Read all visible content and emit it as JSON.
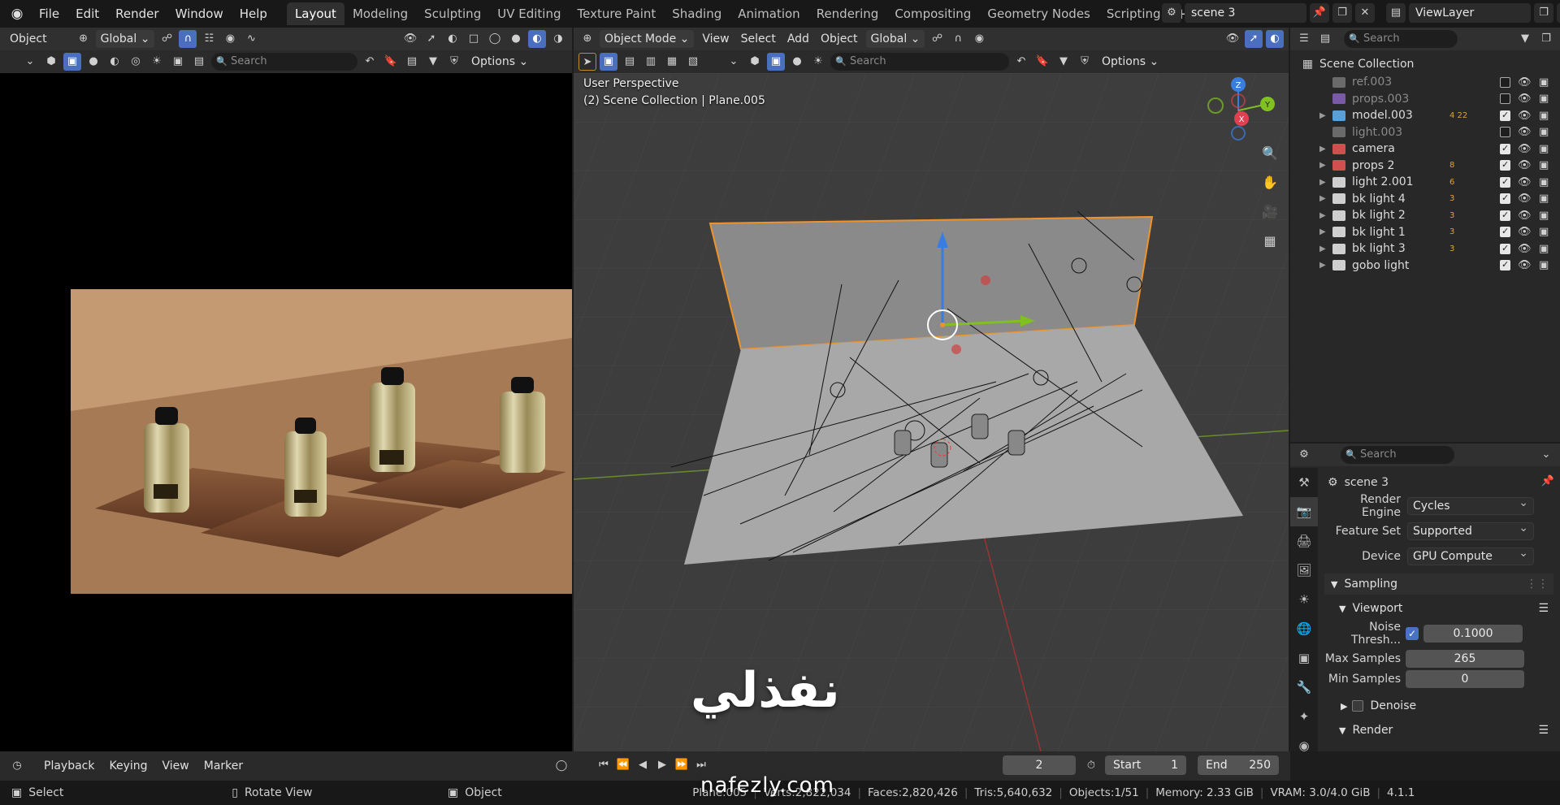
{
  "app": {
    "menus": [
      "File",
      "Edit",
      "Render",
      "Window",
      "Help"
    ],
    "workspaces": [
      "Layout",
      "Modeling",
      "Sculpting",
      "UV Editing",
      "Texture Paint",
      "Shading",
      "Animation",
      "Rendering",
      "Compositing",
      "Geometry Nodes",
      "Scripting"
    ],
    "active_workspace": "Layout",
    "scene_name": "scene  3",
    "view_layer": "ViewLayer"
  },
  "left_header": {
    "mode": "Object",
    "orientation": "Global",
    "search_placeholder": "Search",
    "options": "Options"
  },
  "viewport_header": {
    "mode": "Object Mode",
    "menus": [
      "View",
      "Select",
      "Add",
      "Object"
    ],
    "orientation": "Global",
    "search_placeholder": "Search",
    "options": "Options"
  },
  "viewport": {
    "perspective": "User Perspective",
    "selection": "(2) Scene Collection | Plane.005",
    "gizmo_axes": [
      "Z",
      "Y",
      "X"
    ]
  },
  "outliner": {
    "search_placeholder": "Search",
    "root": "Scene Collection",
    "items": [
      {
        "name": "ref.003",
        "dim": true,
        "checked": false,
        "color": "#6a6a6a",
        "expand": false,
        "badge": ""
      },
      {
        "name": "props.003",
        "dim": true,
        "checked": false,
        "color": "#7a5aa8",
        "expand": false,
        "badge": ""
      },
      {
        "name": "model.003",
        "dim": false,
        "checked": true,
        "color": "#5aa0d6",
        "expand": true,
        "badge": "4 22"
      },
      {
        "name": "light.003",
        "dim": true,
        "checked": false,
        "color": "#6a6a6a",
        "expand": false,
        "badge": ""
      },
      {
        "name": "camera",
        "dim": false,
        "checked": true,
        "color": "#d05050",
        "expand": true,
        "badge": ""
      },
      {
        "name": "props 2",
        "dim": false,
        "checked": true,
        "color": "#d05050",
        "expand": true,
        "badge": "8"
      },
      {
        "name": "light 2.001",
        "dim": false,
        "checked": true,
        "color": "#cfcfcf",
        "expand": true,
        "badge": "6"
      },
      {
        "name": "bk light 4",
        "dim": false,
        "checked": true,
        "color": "#cfcfcf",
        "expand": true,
        "badge": "3"
      },
      {
        "name": "bk light 2",
        "dim": false,
        "checked": true,
        "color": "#cfcfcf",
        "expand": true,
        "badge": "3"
      },
      {
        "name": "bk light 1",
        "dim": false,
        "checked": true,
        "color": "#cfcfcf",
        "expand": true,
        "badge": "3"
      },
      {
        "name": "bk light 3",
        "dim": false,
        "checked": true,
        "color": "#cfcfcf",
        "expand": true,
        "badge": "3"
      },
      {
        "name": "gobo light",
        "dim": false,
        "checked": true,
        "color": "#cfcfcf",
        "expand": true,
        "badge": ""
      }
    ]
  },
  "properties": {
    "search_placeholder": "Search",
    "scene": "scene  3",
    "render_engine_label": "Render Engine",
    "render_engine": "Cycles",
    "feature_set_label": "Feature Set",
    "feature_set": "Supported",
    "device_label": "Device",
    "device": "GPU Compute",
    "sampling": "Sampling",
    "viewport": "Viewport",
    "noise_threshold_label": "Noise Thresh...",
    "noise_threshold": "0.1000",
    "max_samples_label": "Max Samples",
    "max_samples": "265",
    "min_samples_label": "Min Samples",
    "min_samples": "0",
    "denoise": "Denoise",
    "render": "Render"
  },
  "timeline": {
    "menus": [
      "Playback",
      "Keying",
      "View",
      "Marker"
    ],
    "current_frame": "2",
    "start_label": "Start",
    "start": "1",
    "end_label": "End",
    "end": "250"
  },
  "statusbar": {
    "select": "Select",
    "rotate": "Rotate View",
    "object": "Object",
    "stats": [
      "Plane.005",
      "Verts:2,822,034",
      "Faces:2,820,426",
      "Tris:5,640,632",
      "Objects:1/51",
      "Memory: 2.33 GiB",
      "VRAM: 3.0/4.0 GiB",
      "4.1.1"
    ]
  },
  "watermark": {
    "arabic": "نفذلي",
    "latin": "nafezly.com"
  },
  "colors": {
    "accent": "#4a6fbf",
    "selection_outline": "#f0922a",
    "axis_x": "#e04050",
    "axis_y": "#80c020",
    "axis_z": "#3a7de0"
  }
}
